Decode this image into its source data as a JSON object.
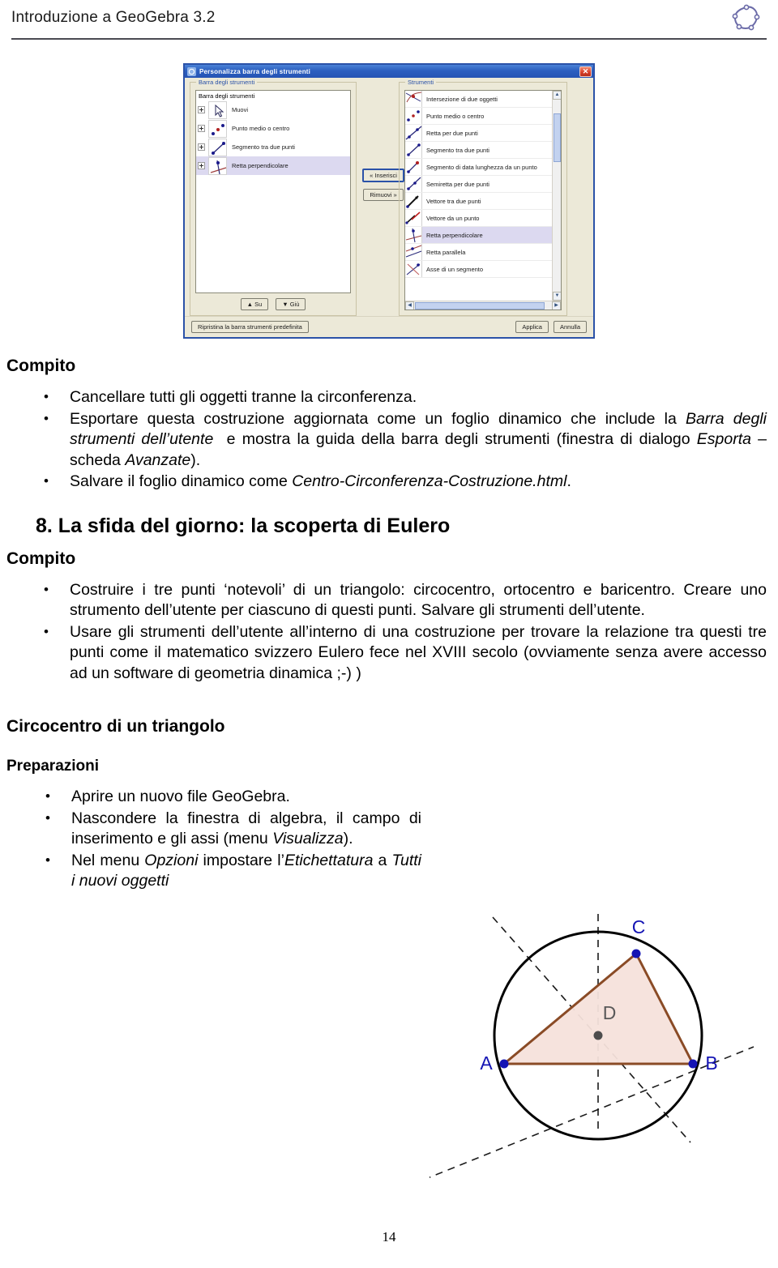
{
  "header": {
    "title": "Introduzione a GeoGebra 3.2",
    "logo_icon": "geogebra-logo-icon"
  },
  "dialog": {
    "title": "Personalizza barra degli strumenti",
    "close_label": "✕",
    "left_panel": {
      "legend": "Barra degli strumenti",
      "list_caption": "Barra degli strumenti",
      "items": [
        {
          "label": "Muovi",
          "icon": "move-arrow-icon",
          "selected": false
        },
        {
          "label": "Punto medio o centro",
          "icon": "midpoint-icon",
          "selected": false
        },
        {
          "label": "Segmento tra due punti",
          "icon": "segment-icon",
          "selected": false
        },
        {
          "label": "Retta perpendicolare",
          "icon": "perpendicular-line-icon",
          "selected": true
        }
      ],
      "up_button": "▲ Su",
      "down_button": "▼ Giù"
    },
    "middle_buttons": {
      "insert": "« Inserisci",
      "remove": "Rimuovi »"
    },
    "right_panel": {
      "legend": "Strumenti",
      "items": [
        {
          "label": "Intersezione di due oggetti",
          "icon": "intersect-icon",
          "selected": false
        },
        {
          "label": "Punto medio o centro",
          "icon": "midpoint-icon",
          "selected": false
        },
        {
          "label": "Retta per due punti",
          "icon": "line-two-points-icon",
          "selected": false
        },
        {
          "label": "Segmento tra due punti",
          "icon": "segment-icon",
          "selected": false
        },
        {
          "label": "Segmento di data lunghezza da un punto",
          "icon": "segment-fixed-length-icon",
          "selected": false
        },
        {
          "label": "Semiretta per due punti",
          "icon": "ray-icon",
          "selected": false
        },
        {
          "label": "Vettore tra due punti",
          "icon": "vector-icon",
          "selected": false
        },
        {
          "label": "Vettore da un punto",
          "icon": "vector-from-point-icon",
          "selected": false
        },
        {
          "label": "Retta perpendicolare",
          "icon": "perpendicular-line-icon",
          "selected": true
        },
        {
          "label": "Retta parallela",
          "icon": "parallel-line-icon",
          "selected": false
        },
        {
          "label": "Asse di un segmento",
          "icon": "perpendicular-bisector-icon",
          "selected": false
        }
      ]
    },
    "footer": {
      "restore": "Ripristina la barra strumenti predefinita",
      "apply": "Applica",
      "cancel": "Annulla"
    }
  },
  "sections": {
    "compito1": {
      "heading": "Compito",
      "bullets": [
        "Cancellare tutti gli oggetti tranne la circonferenza.",
        "Esportare questa costruzione aggiornata come un foglio dinamico che include la Barra degli strumenti dell’utente  e mostra la guida della barra degli strumenti (finestra di dialogo Esporta – scheda Avanzate).",
        "Salvare il foglio dinamico come Centro-Circonferenza-Costruzione.html."
      ]
    },
    "chapter8": {
      "heading": "8. La sfida del giorno: la scoperta di Eulero",
      "compito_heading": "Compito",
      "bullets": [
        "Costruire i tre punti  ‘notevoli’ di un triangolo: circocentro, ortocentro e baricentro. Creare uno strumento dell’utente per ciascuno di questi punti. Salvare gli strumenti dell’utente.",
        "Usare gli strumenti dell’utente all’interno di una costruzione per trovare la relazione tra questi tre punti come il matematico svizzero Eulero fece nel XVIII secolo (ovviamente senza avere accesso ad un  software di geometria dinamica  ;-) )"
      ]
    },
    "circocentro": {
      "heading": "Circocentro di un  triangolo",
      "prep_heading": "Preparazioni",
      "bullets": [
        "Aprire un nuovo file GeoGebra.",
        "Nascondere la finestra di algebra, il campo di inserimento e gli assi (menu Visualizza).",
        "Nel menu Opzioni impostare l’Etichettatura a Tutti i nuovi oggetti"
      ]
    }
  },
  "figure": {
    "name": "circumcenter-triangle-figure",
    "labels": {
      "A": "A",
      "B": "B",
      "C": "C",
      "D": "D"
    },
    "colors": {
      "triangle_stroke": "#8a4b26",
      "triangle_fill": "#f6e2db",
      "point": "#1414b4",
      "center_point": "#4d4d4d",
      "circle": "#000000",
      "label": "#1414b4",
      "center_label": "#595959"
    }
  },
  "footer": {
    "page_number": "14"
  }
}
